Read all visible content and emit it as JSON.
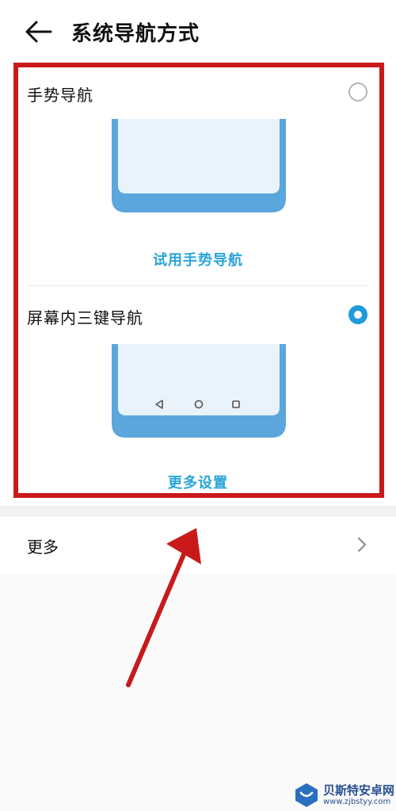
{
  "header": {
    "title": "系统导航方式",
    "back_icon": "back-arrow-icon"
  },
  "options": [
    {
      "label": "手势导航",
      "selected": false,
      "link": "试用手势导航"
    },
    {
      "label": "屏幕内三键导航",
      "selected": true,
      "link": "更多设置",
      "nav_keys": [
        "back-triangle-icon",
        "home-circle-icon",
        "recent-square-icon"
      ]
    }
  ],
  "more": {
    "label": "更多",
    "icon": "chevron-right-icon"
  },
  "colors": {
    "accent": "#1f9bd9",
    "link": "#2aa5d8",
    "annotation_red": "#c9191b",
    "phone_blue": "#5aa6dd"
  },
  "watermark": {
    "name": "贝斯特安卓网",
    "url": "www.zjbstyy.com"
  }
}
